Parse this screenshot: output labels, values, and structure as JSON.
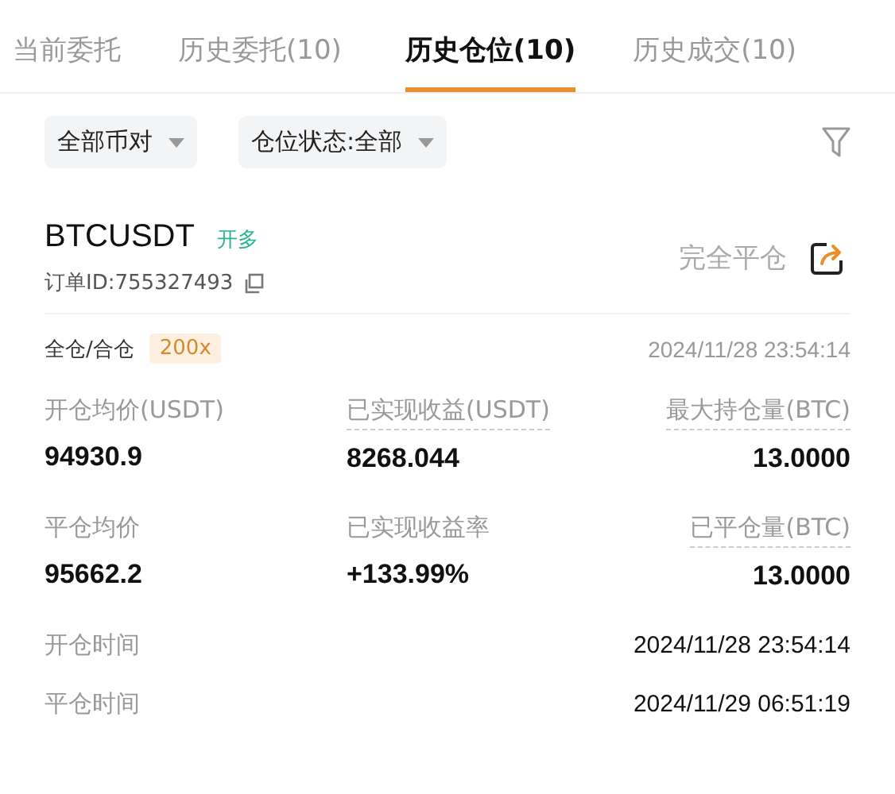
{
  "tabs": [
    {
      "label": "当前委托",
      "selected": false
    },
    {
      "label": "历史委托(10)",
      "selected": false
    },
    {
      "label": "历史仓位(10)",
      "selected": true
    },
    {
      "label": "历史成交(10)",
      "selected": false
    }
  ],
  "filters": [
    "全部币对",
    "仓位状态:全部"
  ],
  "position": {
    "symbol": "BTCUSDT",
    "side": "开多",
    "order_id": "订单ID:755327493",
    "close_action": "完全平仓",
    "margin_mode": "全仓/合仓",
    "leverage": "200x",
    "time": "2024/11/28 23:54:14",
    "metrics": [
      {
        "label": "开仓均价(USDT)",
        "value": "94930.9",
        "dotted": false
      },
      {
        "label": "已实现收益(USDT)",
        "value": "8268.044",
        "dotted": true
      },
      {
        "label": "最大持仓量(BTC)",
        "value": "13.0000",
        "dotted": true
      },
      {
        "label": "平仓均价",
        "value": "95662.2",
        "dotted": false
      },
      {
        "label": "已实现收益率",
        "value": "+133.99%",
        "dotted": false
      },
      {
        "label": "已平仓量(BTC)",
        "value": "13.0000",
        "dotted": true
      }
    ],
    "times": [
      {
        "label": "开仓时间",
        "value": "2024/11/28 23:54:14"
      },
      {
        "label": "平仓时间",
        "value": "2024/11/29 06:51:19"
      }
    ]
  }
}
